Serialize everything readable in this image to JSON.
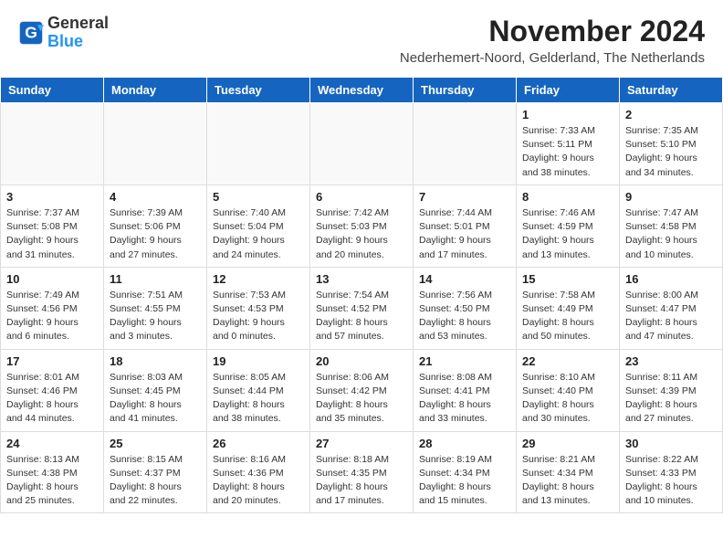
{
  "logo": {
    "line1": "General",
    "line2": "Blue"
  },
  "title": "November 2024",
  "location": "Nederhemert-Noord, Gelderland, The Netherlands",
  "weekdays": [
    "Sunday",
    "Monday",
    "Tuesday",
    "Wednesday",
    "Thursday",
    "Friday",
    "Saturday"
  ],
  "weeks": [
    [
      {
        "day": "",
        "info": ""
      },
      {
        "day": "",
        "info": ""
      },
      {
        "day": "",
        "info": ""
      },
      {
        "day": "",
        "info": ""
      },
      {
        "day": "",
        "info": ""
      },
      {
        "day": "1",
        "info": "Sunrise: 7:33 AM\nSunset: 5:11 PM\nDaylight: 9 hours\nand 38 minutes."
      },
      {
        "day": "2",
        "info": "Sunrise: 7:35 AM\nSunset: 5:10 PM\nDaylight: 9 hours\nand 34 minutes."
      }
    ],
    [
      {
        "day": "3",
        "info": "Sunrise: 7:37 AM\nSunset: 5:08 PM\nDaylight: 9 hours\nand 31 minutes."
      },
      {
        "day": "4",
        "info": "Sunrise: 7:39 AM\nSunset: 5:06 PM\nDaylight: 9 hours\nand 27 minutes."
      },
      {
        "day": "5",
        "info": "Sunrise: 7:40 AM\nSunset: 5:04 PM\nDaylight: 9 hours\nand 24 minutes."
      },
      {
        "day": "6",
        "info": "Sunrise: 7:42 AM\nSunset: 5:03 PM\nDaylight: 9 hours\nand 20 minutes."
      },
      {
        "day": "7",
        "info": "Sunrise: 7:44 AM\nSunset: 5:01 PM\nDaylight: 9 hours\nand 17 minutes."
      },
      {
        "day": "8",
        "info": "Sunrise: 7:46 AM\nSunset: 4:59 PM\nDaylight: 9 hours\nand 13 minutes."
      },
      {
        "day": "9",
        "info": "Sunrise: 7:47 AM\nSunset: 4:58 PM\nDaylight: 9 hours\nand 10 minutes."
      }
    ],
    [
      {
        "day": "10",
        "info": "Sunrise: 7:49 AM\nSunset: 4:56 PM\nDaylight: 9 hours\nand 6 minutes."
      },
      {
        "day": "11",
        "info": "Sunrise: 7:51 AM\nSunset: 4:55 PM\nDaylight: 9 hours\nand 3 minutes."
      },
      {
        "day": "12",
        "info": "Sunrise: 7:53 AM\nSunset: 4:53 PM\nDaylight: 9 hours\nand 0 minutes."
      },
      {
        "day": "13",
        "info": "Sunrise: 7:54 AM\nSunset: 4:52 PM\nDaylight: 8 hours\nand 57 minutes."
      },
      {
        "day": "14",
        "info": "Sunrise: 7:56 AM\nSunset: 4:50 PM\nDaylight: 8 hours\nand 53 minutes."
      },
      {
        "day": "15",
        "info": "Sunrise: 7:58 AM\nSunset: 4:49 PM\nDaylight: 8 hours\nand 50 minutes."
      },
      {
        "day": "16",
        "info": "Sunrise: 8:00 AM\nSunset: 4:47 PM\nDaylight: 8 hours\nand 47 minutes."
      }
    ],
    [
      {
        "day": "17",
        "info": "Sunrise: 8:01 AM\nSunset: 4:46 PM\nDaylight: 8 hours\nand 44 minutes."
      },
      {
        "day": "18",
        "info": "Sunrise: 8:03 AM\nSunset: 4:45 PM\nDaylight: 8 hours\nand 41 minutes."
      },
      {
        "day": "19",
        "info": "Sunrise: 8:05 AM\nSunset: 4:44 PM\nDaylight: 8 hours\nand 38 minutes."
      },
      {
        "day": "20",
        "info": "Sunrise: 8:06 AM\nSunset: 4:42 PM\nDaylight: 8 hours\nand 35 minutes."
      },
      {
        "day": "21",
        "info": "Sunrise: 8:08 AM\nSunset: 4:41 PM\nDaylight: 8 hours\nand 33 minutes."
      },
      {
        "day": "22",
        "info": "Sunrise: 8:10 AM\nSunset: 4:40 PM\nDaylight: 8 hours\nand 30 minutes."
      },
      {
        "day": "23",
        "info": "Sunrise: 8:11 AM\nSunset: 4:39 PM\nDaylight: 8 hours\nand 27 minutes."
      }
    ],
    [
      {
        "day": "24",
        "info": "Sunrise: 8:13 AM\nSunset: 4:38 PM\nDaylight: 8 hours\nand 25 minutes."
      },
      {
        "day": "25",
        "info": "Sunrise: 8:15 AM\nSunset: 4:37 PM\nDaylight: 8 hours\nand 22 minutes."
      },
      {
        "day": "26",
        "info": "Sunrise: 8:16 AM\nSunset: 4:36 PM\nDaylight: 8 hours\nand 20 minutes."
      },
      {
        "day": "27",
        "info": "Sunrise: 8:18 AM\nSunset: 4:35 PM\nDaylight: 8 hours\nand 17 minutes."
      },
      {
        "day": "28",
        "info": "Sunrise: 8:19 AM\nSunset: 4:34 PM\nDaylight: 8 hours\nand 15 minutes."
      },
      {
        "day": "29",
        "info": "Sunrise: 8:21 AM\nSunset: 4:34 PM\nDaylight: 8 hours\nand 13 minutes."
      },
      {
        "day": "30",
        "info": "Sunrise: 8:22 AM\nSunset: 4:33 PM\nDaylight: 8 hours\nand 10 minutes."
      }
    ]
  ]
}
